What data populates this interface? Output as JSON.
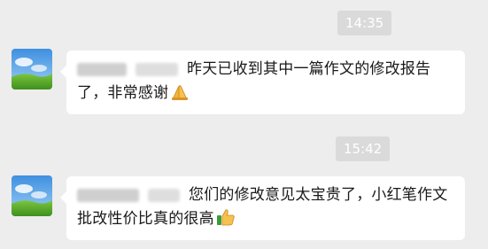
{
  "chat": {
    "messages": [
      {
        "timestamp": "14:35",
        "sender": "",
        "text": "昨天已收到其中一篇作文的修改报告了，非常感谢",
        "emoji": "folded-hands-icon"
      },
      {
        "timestamp": "15:42",
        "sender": "",
        "text": "您们的修改意见太宝贵了，小红笔作文批改性价比真的很高",
        "emoji": "thumbs-up-icon"
      }
    ]
  },
  "colors": {
    "background": "#ededed",
    "bubble": "#ffffff",
    "timestamp_bg": "#dadada",
    "timestamp_text": "#ffffff",
    "text": "#191919"
  }
}
